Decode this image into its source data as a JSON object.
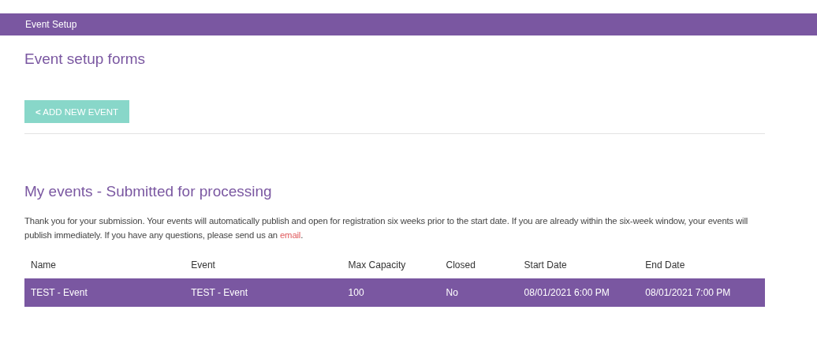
{
  "banner": {
    "title": "Event Setup"
  },
  "page_title": "Event setup forms",
  "add_button": {
    "icon": "<",
    "label": "ADD NEW EVENT"
  },
  "section_title": "My events - Submitted for processing",
  "notice": {
    "text": "Thank you for your submission. Your events will automatically publish and open for registration six weeks prior to the start date. If you are already within the six-week window, your events will publish immediately.  If you have any questions, please send us an ",
    "link": "email",
    "end": "."
  },
  "table": {
    "columns": [
      "Name",
      "Event",
      "Max Capacity",
      "Closed",
      "Start Date",
      "End Date"
    ],
    "rows": [
      {
        "selected": true,
        "cells": [
          "TEST - Event",
          "TEST - Event",
          "100",
          "No",
          "08/01/2021 6:00 PM",
          "08/01/2021 7:00 PM"
        ]
      }
    ]
  }
}
